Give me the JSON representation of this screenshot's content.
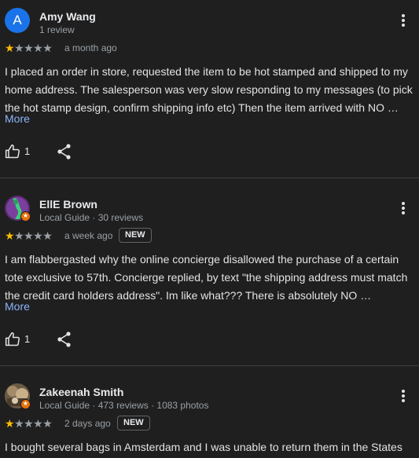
{
  "reviews": [
    {
      "name": "Amy Wang",
      "meta": "1 review",
      "avatar_letter": "A",
      "avatar_color": "#1a73e8",
      "rating": 1,
      "time": "a month ago",
      "badge": "",
      "text": "I placed an order in store, requested the item to be hot stamped and shipped to my home address. The salesperson was very slow responding to my messages (to pick the hot stamp design, confirm shipping info etc) Then the item arrived with NO …",
      "more_label": "More",
      "likes": "1"
    },
    {
      "name": "EllE Brown",
      "meta": "Local Guide · 30 reviews",
      "rating": 1,
      "time": "a week ago",
      "badge": "NEW",
      "text": "I am flabbergasted why the online concierge disallowed the purchase of a certain tote exclusive to 57th. Concierge replied, by text \"the shipping address must match the credit card holders address\". Im like what??? There is absolutely NO …",
      "more_label": "More",
      "likes": "1"
    },
    {
      "name": "Zakeenah Smith",
      "meta": "Local Guide · 473 reviews · 1083 photos",
      "rating": 1,
      "time": "2 days ago",
      "badge": "NEW",
      "text": "I bought several bags in Amsterdam and I was unable to return them in the States"
    }
  ],
  "colors": {
    "background": "#1f1f1f",
    "star_filled": "#fbbc04",
    "link": "#8ab4f8",
    "local_guide_badge": "#e8710a"
  },
  "icons": [
    "more-vert-icon",
    "thumb-up-icon",
    "share-icon",
    "star-icon",
    "local-guide-badge-icon"
  ]
}
